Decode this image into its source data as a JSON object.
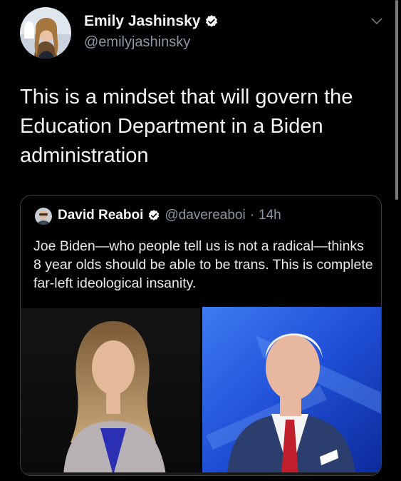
{
  "tweet": {
    "author_name": "Emily Jashinsky",
    "author_handle": "@emilyjashinsky",
    "text": "This is a mindset that will govern the Education Department in a Biden administration",
    "menu_icon": "chevron-down-icon",
    "verified_icon": "verified-badge-icon"
  },
  "quote": {
    "author_name": "David Reaboi",
    "author_handle": "@davereaboi",
    "separator": "·",
    "time": "14h",
    "text": "Joe Biden—who people tell us is not a radical—thinks 8 year olds should be able to be trans. This is complete far-left ideological insanity.",
    "media_caption": "",
    "verified_icon": "verified-badge-icon"
  },
  "colors": {
    "background": "#000000",
    "text_primary": "#e7e9ea",
    "text_secondary": "#8b98a5",
    "border": "#3a3d40",
    "media_blue": "#1f4fd6"
  }
}
